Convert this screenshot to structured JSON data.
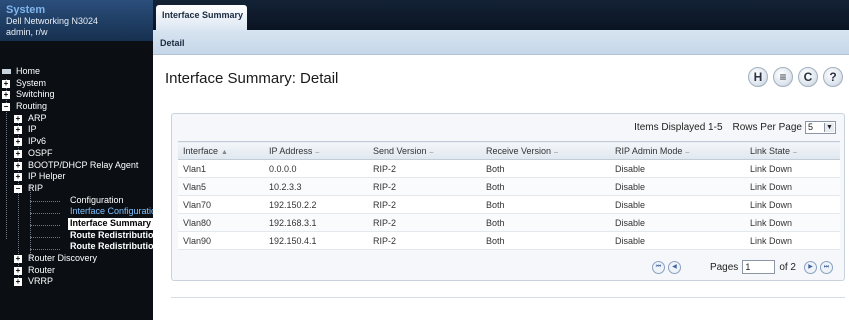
{
  "system": {
    "title": "System",
    "model": "Dell Networking N3024",
    "user": "admin, r/w"
  },
  "nav": [
    {
      "label": "Home"
    },
    {
      "label": "System",
      "expander": "+"
    },
    {
      "label": "Switching",
      "expander": "+"
    },
    {
      "label": "Routing",
      "expander": "−"
    },
    {
      "label": "ARP",
      "expander": "+"
    },
    {
      "label": "IP",
      "expander": "+"
    },
    {
      "label": "IPv6",
      "expander": "+"
    },
    {
      "label": "OSPF",
      "expander": "+"
    },
    {
      "label": "BOOTP/DHCP Relay Agent",
      "expander": "+"
    },
    {
      "label": "IP Helper",
      "expander": "+"
    },
    {
      "label": "RIP",
      "expander": "−"
    },
    {
      "label": "Configuration"
    },
    {
      "label": "Interface Configuration"
    },
    {
      "label": "Interface Summary"
    },
    {
      "label": "Route Redistribution"
    },
    {
      "label": "Route Redistribution"
    },
    {
      "label": "Router Discovery",
      "expander": "+"
    },
    {
      "label": "Router",
      "expander": "+"
    },
    {
      "label": "VRRP",
      "expander": "+"
    }
  ],
  "tabs": {
    "main_tab": "Interface Summary",
    "sub_tab": "Detail"
  },
  "page": {
    "title": "Interface Summary: Detail"
  },
  "toolbar": {
    "icons": [
      {
        "icon": "help-h-icon",
        "glyph": "H"
      },
      {
        "icon": "print-icon",
        "glyph": "≡"
      },
      {
        "icon": "refresh-icon",
        "glyph": "C"
      },
      {
        "icon": "help-icon",
        "glyph": "?"
      }
    ]
  },
  "table": {
    "items_displayed": "Items Displayed 1-5",
    "rows_per_page_label": "Rows Per Page",
    "rows_per_page_value": "5",
    "columns": [
      "Interface",
      "IP Address",
      "Send Version",
      "Receive Version",
      "RIP Admin Mode",
      "Link State"
    ],
    "rows": [
      [
        "Vlan1",
        "0.0.0.0",
        "RIP-2",
        "Both",
        "Disable",
        "Link Down"
      ],
      [
        "Vlan5",
        "10.2.3.3",
        "RIP-2",
        "Both",
        "Disable",
        "Link Down"
      ],
      [
        "Vlan70",
        "192.150.2.2",
        "RIP-2",
        "Both",
        "Disable",
        "Link Down"
      ],
      [
        "Vlan80",
        "192.168.3.1",
        "RIP-2",
        "Both",
        "Disable",
        "Link Down"
      ],
      [
        "Vlan90",
        "192.150.4.1",
        "RIP-2",
        "Both",
        "Disable",
        "Link Down"
      ]
    ]
  },
  "pager": {
    "label": "Pages",
    "current": "1",
    "of_text": "of 2"
  }
}
